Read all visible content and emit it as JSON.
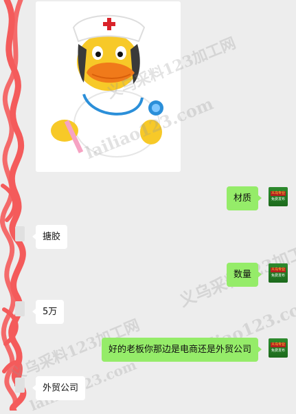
{
  "messages": [
    {
      "id": "m1",
      "side": "sent",
      "text": "材质"
    },
    {
      "id": "m2",
      "side": "recv",
      "text": "搪胶"
    },
    {
      "id": "m3",
      "side": "sent",
      "text": "数量"
    },
    {
      "id": "m4",
      "side": "recv",
      "text": "5万"
    },
    {
      "id": "m5",
      "side": "sent",
      "text": "好的老板你那边是电商还是外贸公司"
    },
    {
      "id": "m6",
      "side": "recv",
      "text": "外贸公司"
    }
  ],
  "avatar": {
    "line1": "义乌专业",
    "line2": "免费发布"
  },
  "watermarks": {
    "cn": "义乌采料123加工网",
    "en": "lailiao123.com"
  },
  "colors": {
    "background": "#ededed",
    "sent_bubble": "#95ec69",
    "recv_bubble": "#ffffff",
    "redaction": "#f45b5b"
  },
  "image_icon": "nurse-duck-image"
}
